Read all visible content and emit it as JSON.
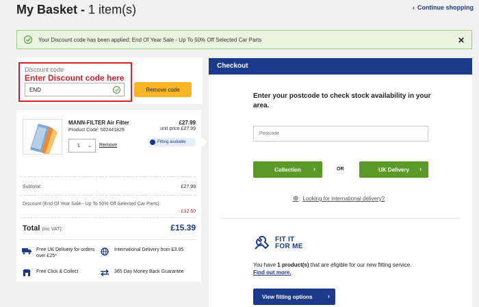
{
  "header": {
    "title_bold": "My Basket - ",
    "title_count": "1 item(s)",
    "continue_label": "Continue shopping"
  },
  "banner": {
    "message": "Your Discount code has been applied: End Of Year Sale - Up To 50% Off Selected Car Parts",
    "close_glyph": "✕"
  },
  "discount": {
    "label": "Discount code",
    "annotation": "Enter Discount code here",
    "code_value": "END",
    "remove_label": "Remove code"
  },
  "item": {
    "name": "MANN-FILTER Air Filter",
    "product_code": "Product Code: 502441829",
    "price": "£27.99",
    "unit_price": "unit price £27.99",
    "quantity": "1",
    "remove_label": "Remove",
    "fitting_badge": "Fitting available"
  },
  "summary": {
    "subtotal_label": "Subtotal:",
    "subtotal_value": "£27.99",
    "discount_label": "Discount (End Of Year Sale - Up To 50% Off Selected Car Parts):",
    "discount_value": "- £12.60",
    "total_label": "Total",
    "total_note": "(inc VAT):",
    "total_value": "£15.39"
  },
  "perks": [
    {
      "icon": "truck-icon",
      "text": "Free UK Delivery for orders over £25*"
    },
    {
      "icon": "globe-icon",
      "text": "International Delivery from £3.95"
    },
    {
      "icon": "store-icon",
      "text": "Free Click & Collect"
    },
    {
      "icon": "exchange-icon",
      "text": "365 Day Money Back Guarantee"
    }
  ],
  "checkout": {
    "heading": "Checkout",
    "stock_text": "Enter your postcode to check stock availability in your area.",
    "postcode_placeholder": "Postcode",
    "collection_label": "Collection",
    "or_label": "OR",
    "delivery_label": "UK Delivery",
    "intl_link": "Looking for international delivery?",
    "fit_logo_line1": "FIT IT",
    "fit_logo_line2": "FOR ME",
    "eligible_prefix": "You have ",
    "eligible_count": "1 product(s)",
    "eligible_suffix": " that are eligible for our new fitting service.",
    "find_out": "Find out more.",
    "view_fitting": "View fitting options"
  },
  "colors": {
    "brand_blue": "#1b3a8c",
    "green": "#5a9a28",
    "amber": "#f8b626",
    "red": "#d4202a"
  }
}
